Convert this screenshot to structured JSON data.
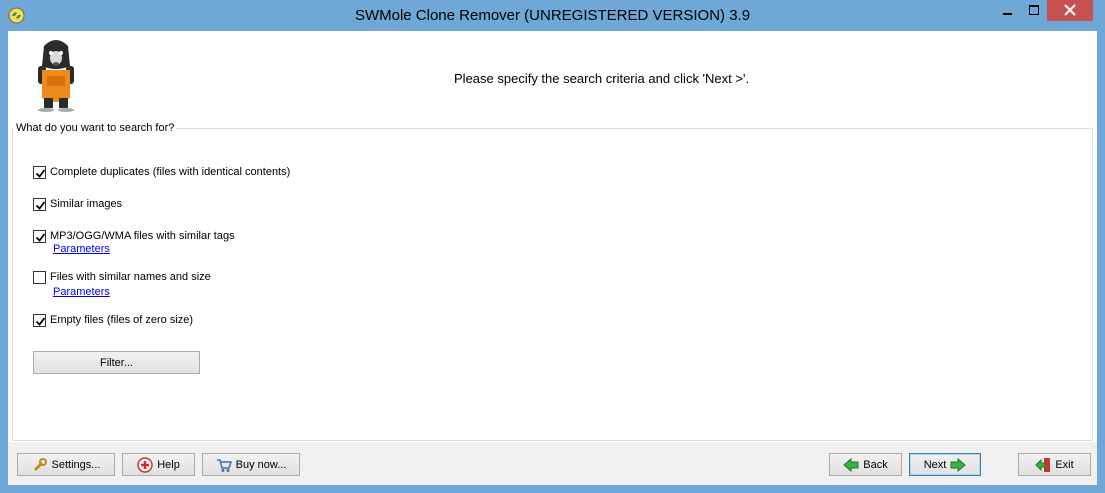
{
  "window": {
    "title": "SWMole Clone Remover (UNREGISTERED VERSION) 3.9"
  },
  "header": {
    "message": "Please specify the search criteria and click 'Next >'."
  },
  "group": {
    "label": "What do you want to search for?"
  },
  "options": [
    {
      "label": "Complete duplicates (files with identical contents)",
      "checked": true
    },
    {
      "label": "Similar images",
      "checked": true
    },
    {
      "label": "MP3/OGG/WMA files with similar tags",
      "checked": true,
      "link": "Parameters"
    },
    {
      "label": "Files with similar names and size",
      "checked": false,
      "link": "Parameters"
    },
    {
      "label": "Empty files (files of zero size)",
      "checked": true
    }
  ],
  "buttons": {
    "filter": "Filter...",
    "settings": "Settings...",
    "help": "Help",
    "buy": "Buy now...",
    "back": "Back",
    "next": "Next",
    "exit": "Exit"
  },
  "colors": {
    "titlebar": "#6fa8d6",
    "close": "#c75050",
    "link": "#0000ee"
  }
}
